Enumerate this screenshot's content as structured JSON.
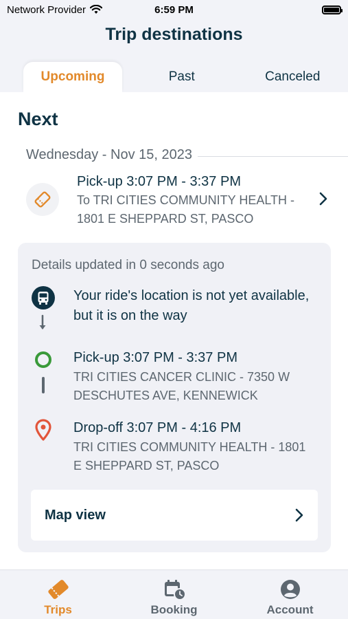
{
  "status_bar": {
    "carrier": "Network Provider",
    "time": "6:59 PM",
    "wifi_icon": "wifi-icon",
    "battery_level": 1.0
  },
  "header": {
    "title": "Trip destinations"
  },
  "tabs": [
    {
      "label": "Upcoming",
      "active": true
    },
    {
      "label": "Past",
      "active": false
    },
    {
      "label": "Canceled",
      "active": false
    }
  ],
  "main": {
    "section_title": "Next",
    "date": "Wednesday - Nov 15, 2023",
    "trip": {
      "icon": "ticket-icon",
      "pickup": "Pick-up 3:07 PM - 3:37 PM",
      "destination": "To TRI CITIES COMMUNITY HEALTH - 1801 E SHEPPARD ST, PASCO"
    },
    "details": {
      "updated": "Details updated in 0 seconds ago",
      "ride_status": "Your ride's location is not yet available, but it is on the way",
      "pickup_title": "Pick-up 3:07 PM - 3:37 PM",
      "pickup_address": "TRI CITIES CANCER CLINIC - 7350 W DESCHUTES AVE, KENNEWICK",
      "dropoff_title": "Drop-off 3:07 PM - 4:16 PM",
      "dropoff_address": "TRI CITIES COMMUNITY HEALTH - 1801 E SHEPPARD ST, PASCO",
      "map_label": "Map view"
    }
  },
  "bottom_nav": [
    {
      "label": "Trips",
      "icon": "ticket-icon",
      "active": true
    },
    {
      "label": "Booking",
      "icon": "calendar-clock-icon",
      "active": false
    },
    {
      "label": "Account",
      "icon": "account-icon",
      "active": false
    }
  ],
  "colors": {
    "accent": "#e2892a",
    "primary_text": "#0f3344",
    "secondary_text": "#5d6770",
    "pickup_green": "#3a9a3a",
    "dropoff_red": "#e2553a"
  }
}
